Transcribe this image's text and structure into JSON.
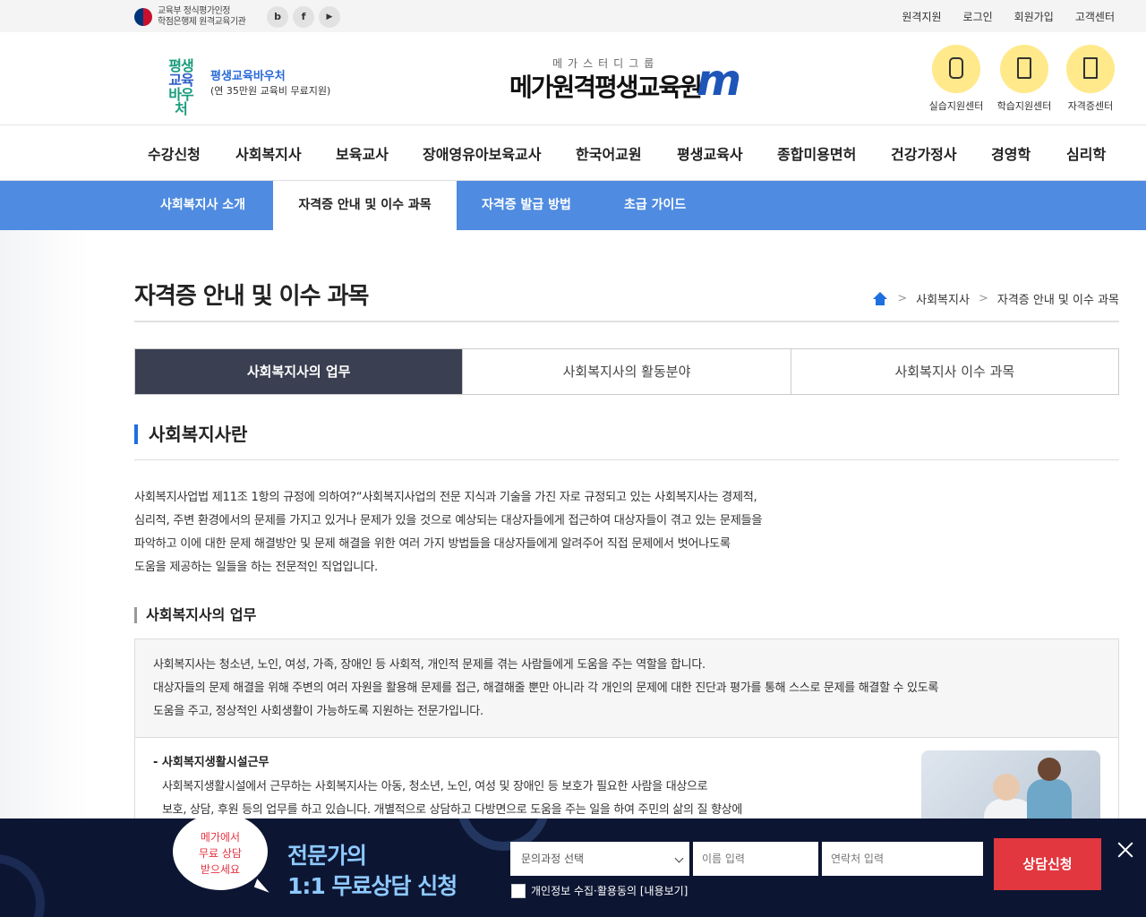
{
  "topbar": {
    "accreditation_line1": "교육부 정식평가인정",
    "accreditation_line2": "학점은행제 원격교육기관",
    "sns": [
      "b",
      "f",
      "▶"
    ],
    "links": [
      "원격지원",
      "로그인",
      "회원가입",
      "고객센터"
    ]
  },
  "header": {
    "voucher_logo": [
      "평생",
      "교육",
      "바우처"
    ],
    "voucher_title": "평생교육바우처",
    "voucher_sub": "(연 35만원 교육비 무료지원)",
    "brand_sub": "메가스터디그룹",
    "brand": "메가원격평생교육원",
    "utils": [
      "실습지원센터",
      "학습지원센터",
      "자격증센터"
    ]
  },
  "gnb": [
    "수강신청",
    "사회복지사",
    "보육교사",
    "장애영유아보육교사",
    "한국어교원",
    "평생교육사",
    "종합미용면허",
    "건강가정사",
    "경영학",
    "심리학"
  ],
  "subnav": [
    "사회복지사 소개",
    "자격증 안내 및 이수 과목",
    "자격증 발급 방법",
    "초급 가이드"
  ],
  "page": {
    "title": "자격증 안내 및 이수 과목",
    "breadcrumb": [
      "사회복지사",
      "자격증 안내 및 이수 과목"
    ]
  },
  "tabs": [
    "사회복지사의 업무",
    "사회복지사의 활동분야",
    "사회복지사 이수 과목"
  ],
  "section": {
    "heading": "사회복지사란",
    "intro": [
      "사회복지사업법 제11조 1항의 규정에 의하여?“사회복지사업의 전문 지식과 기술을 가진 자로 규정되고 있는 사회복지사는 경제적,",
      "심리적, 주변 환경에서의 문제를 가지고 있거나 문제가 있을 것으로 예상되는 대상자들에게 접근하여 대상자들이 겪고 있는 문제들을",
      "파악하고 이에 대한 문제 해결방안 및 문제 해결을 위한 여러 가지 방법들을 대상자들에게 알려주어 직접 문제에서 벗어나도록",
      "도움을 제공하는 일들을 하는 전문적인 직업입니다."
    ],
    "sub_heading": "사회복지사의 업무",
    "box_top": [
      "사회복지사는 청소년, 노인, 여성, 가족, 장애인 등 사회적, 개인적 문제를 겪는 사람들에게 도움을 주는 역할을 합니다.",
      "대상자들의 문제 해결을 위해 주변의 여러 자원을 활용해 문제를 접근, 해결해줄 뿐만 아니라 각 개인의 문제에 대한 진단과 평가를 통해 스스로 문제를 해결할 수 있도록",
      "도움을 주고, 정상적인 사회생활이 가능하도록 지원하는 전문가입니다."
    ],
    "item_title": "- 사회복지생활시설근무",
    "item_body": [
      "사회복지생활시설에서 근무하는 사회복지사는 아동, 청소년, 노인, 여성 및 장애인 등 보호가 필요한 사람을 대상으로",
      "보호, 상담, 후원 등의 업무를 하고 있습니다. 개별적으로 상담하고 다방면으로 도움을 주는 일을 하여 주민의 삶의 질 향상에"
    ]
  },
  "footer_bar": {
    "bubble": [
      "메가에서",
      "무료 상담",
      "받으세요"
    ],
    "cta_line1": "전문가의",
    "cta_line2": "1:1 무료상담 신청",
    "select_placeholder": "문의과정 선택",
    "name_placeholder": "이름 입력",
    "phone_placeholder": "연락처 입력",
    "submit": "상담신청",
    "agree": "개인정보 수집·활용동의 [내용보기]"
  }
}
